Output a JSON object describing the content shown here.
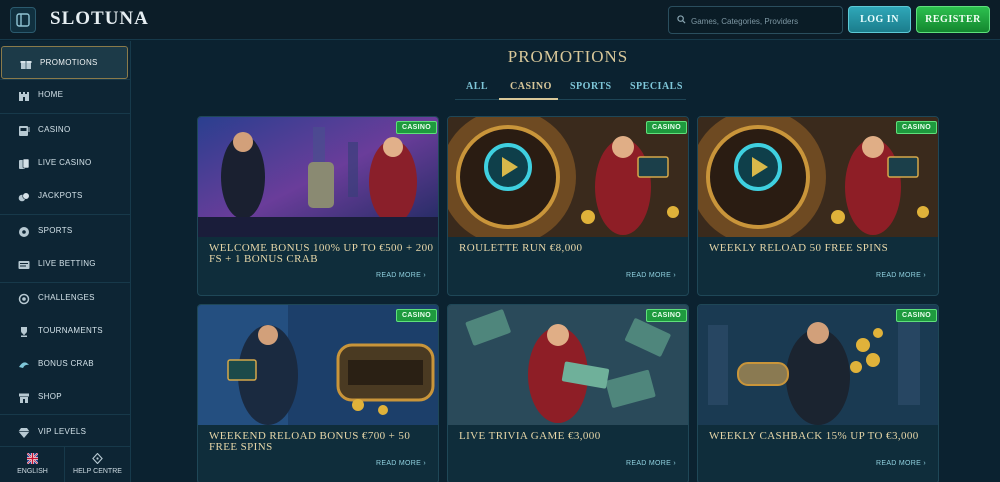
{
  "header": {
    "logo": "SLOTUNA",
    "search_placeholder": "Games, Categories, Providers",
    "login_label": "LOG IN",
    "register_label": "REGISTER"
  },
  "sidebar": {
    "items": [
      {
        "label": "PROMOTIONS",
        "icon": "gift-icon"
      },
      {
        "label": "HOME",
        "icon": "castle-icon"
      },
      {
        "label": "CASINO",
        "icon": "slot-machine-icon"
      },
      {
        "label": "LIVE CASINO",
        "icon": "cards-icon"
      },
      {
        "label": "JACKPOTS",
        "icon": "coins-icon"
      },
      {
        "label": "SPORTS",
        "icon": "ball-icon"
      },
      {
        "label": "LIVE BETTING",
        "icon": "live-screen-icon"
      },
      {
        "label": "CHALLENGES",
        "icon": "medal-icon"
      },
      {
        "label": "TOURNAMENTS",
        "icon": "trophy-icon"
      },
      {
        "label": "BONUS CRAB",
        "icon": "crab-icon"
      },
      {
        "label": "SHOP",
        "icon": "shop-icon"
      },
      {
        "label": "VIP LEVELS",
        "icon": "diamond-icon"
      }
    ],
    "footer": {
      "language_label": "ENGLISH",
      "help_label": "HELP CENTRE"
    }
  },
  "main": {
    "title": "PROMOTIONS",
    "tabs": [
      {
        "label": "ALL"
      },
      {
        "label": "CASINO"
      },
      {
        "label": "SPORTS"
      },
      {
        "label": "SPECIALS"
      }
    ],
    "active_tab": "CASINO",
    "badge_label": "CASINO",
    "read_more_label": "READ MORE ›",
    "cards": [
      {
        "title": "WELCOME BONUS 100% UP TO €500 + 200 FS + 1 BONUS CRAB"
      },
      {
        "title": "ROULETTE RUN €8,000"
      },
      {
        "title": "WEEKLY RELOAD 50 FREE SPINS"
      },
      {
        "title": "WEEKEND RELOAD BONUS €700 + 50 FREE SPINS"
      },
      {
        "title": "LIVE TRIVIA GAME €3,000"
      },
      {
        "title": "WEEKLY CASHBACK 15% UP TO €3,000"
      }
    ]
  },
  "colors": {
    "background": "#0b2230",
    "gold": "#d9c89a",
    "teal": "#2fa7b8",
    "green": "#2cc04f"
  }
}
